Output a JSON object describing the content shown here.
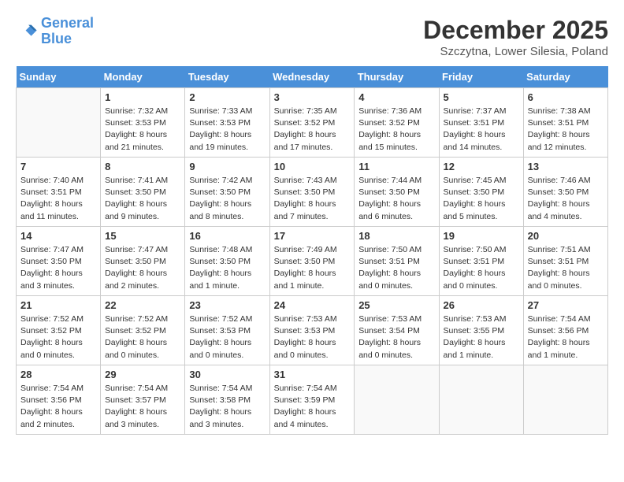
{
  "header": {
    "logo_line1": "General",
    "logo_line2": "Blue",
    "month_title": "December 2025",
    "location": "Szczytna, Lower Silesia, Poland"
  },
  "days_of_week": [
    "Sunday",
    "Monday",
    "Tuesday",
    "Wednesday",
    "Thursday",
    "Friday",
    "Saturday"
  ],
  "weeks": [
    [
      {
        "day": "",
        "info": ""
      },
      {
        "day": "1",
        "info": "Sunrise: 7:32 AM\nSunset: 3:53 PM\nDaylight: 8 hours\nand 21 minutes."
      },
      {
        "day": "2",
        "info": "Sunrise: 7:33 AM\nSunset: 3:53 PM\nDaylight: 8 hours\nand 19 minutes."
      },
      {
        "day": "3",
        "info": "Sunrise: 7:35 AM\nSunset: 3:52 PM\nDaylight: 8 hours\nand 17 minutes."
      },
      {
        "day": "4",
        "info": "Sunrise: 7:36 AM\nSunset: 3:52 PM\nDaylight: 8 hours\nand 15 minutes."
      },
      {
        "day": "5",
        "info": "Sunrise: 7:37 AM\nSunset: 3:51 PM\nDaylight: 8 hours\nand 14 minutes."
      },
      {
        "day": "6",
        "info": "Sunrise: 7:38 AM\nSunset: 3:51 PM\nDaylight: 8 hours\nand 12 minutes."
      }
    ],
    [
      {
        "day": "7",
        "info": "Sunrise: 7:40 AM\nSunset: 3:51 PM\nDaylight: 8 hours\nand 11 minutes."
      },
      {
        "day": "8",
        "info": "Sunrise: 7:41 AM\nSunset: 3:50 PM\nDaylight: 8 hours\nand 9 minutes."
      },
      {
        "day": "9",
        "info": "Sunrise: 7:42 AM\nSunset: 3:50 PM\nDaylight: 8 hours\nand 8 minutes."
      },
      {
        "day": "10",
        "info": "Sunrise: 7:43 AM\nSunset: 3:50 PM\nDaylight: 8 hours\nand 7 minutes."
      },
      {
        "day": "11",
        "info": "Sunrise: 7:44 AM\nSunset: 3:50 PM\nDaylight: 8 hours\nand 6 minutes."
      },
      {
        "day": "12",
        "info": "Sunrise: 7:45 AM\nSunset: 3:50 PM\nDaylight: 8 hours\nand 5 minutes."
      },
      {
        "day": "13",
        "info": "Sunrise: 7:46 AM\nSunset: 3:50 PM\nDaylight: 8 hours\nand 4 minutes."
      }
    ],
    [
      {
        "day": "14",
        "info": "Sunrise: 7:47 AM\nSunset: 3:50 PM\nDaylight: 8 hours\nand 3 minutes."
      },
      {
        "day": "15",
        "info": "Sunrise: 7:47 AM\nSunset: 3:50 PM\nDaylight: 8 hours\nand 2 minutes."
      },
      {
        "day": "16",
        "info": "Sunrise: 7:48 AM\nSunset: 3:50 PM\nDaylight: 8 hours\nand 1 minute."
      },
      {
        "day": "17",
        "info": "Sunrise: 7:49 AM\nSunset: 3:50 PM\nDaylight: 8 hours\nand 1 minute."
      },
      {
        "day": "18",
        "info": "Sunrise: 7:50 AM\nSunset: 3:51 PM\nDaylight: 8 hours\nand 0 minutes."
      },
      {
        "day": "19",
        "info": "Sunrise: 7:50 AM\nSunset: 3:51 PM\nDaylight: 8 hours\nand 0 minutes."
      },
      {
        "day": "20",
        "info": "Sunrise: 7:51 AM\nSunset: 3:51 PM\nDaylight: 8 hours\nand 0 minutes."
      }
    ],
    [
      {
        "day": "21",
        "info": "Sunrise: 7:52 AM\nSunset: 3:52 PM\nDaylight: 8 hours\nand 0 minutes."
      },
      {
        "day": "22",
        "info": "Sunrise: 7:52 AM\nSunset: 3:52 PM\nDaylight: 8 hours\nand 0 minutes."
      },
      {
        "day": "23",
        "info": "Sunrise: 7:52 AM\nSunset: 3:53 PM\nDaylight: 8 hours\nand 0 minutes."
      },
      {
        "day": "24",
        "info": "Sunrise: 7:53 AM\nSunset: 3:53 PM\nDaylight: 8 hours\nand 0 minutes."
      },
      {
        "day": "25",
        "info": "Sunrise: 7:53 AM\nSunset: 3:54 PM\nDaylight: 8 hours\nand 0 minutes."
      },
      {
        "day": "26",
        "info": "Sunrise: 7:53 AM\nSunset: 3:55 PM\nDaylight: 8 hours\nand 1 minute."
      },
      {
        "day": "27",
        "info": "Sunrise: 7:54 AM\nSunset: 3:56 PM\nDaylight: 8 hours\nand 1 minute."
      }
    ],
    [
      {
        "day": "28",
        "info": "Sunrise: 7:54 AM\nSunset: 3:56 PM\nDaylight: 8 hours\nand 2 minutes."
      },
      {
        "day": "29",
        "info": "Sunrise: 7:54 AM\nSunset: 3:57 PM\nDaylight: 8 hours\nand 3 minutes."
      },
      {
        "day": "30",
        "info": "Sunrise: 7:54 AM\nSunset: 3:58 PM\nDaylight: 8 hours\nand 3 minutes."
      },
      {
        "day": "31",
        "info": "Sunrise: 7:54 AM\nSunset: 3:59 PM\nDaylight: 8 hours\nand 4 minutes."
      },
      {
        "day": "",
        "info": ""
      },
      {
        "day": "",
        "info": ""
      },
      {
        "day": "",
        "info": ""
      }
    ]
  ]
}
